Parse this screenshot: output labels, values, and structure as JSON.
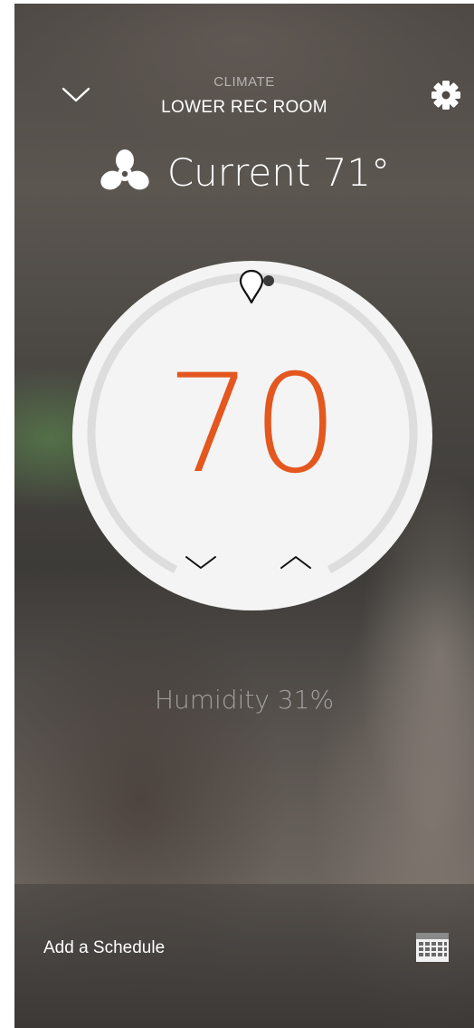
{
  "header": {
    "section_label": "CLIMATE",
    "room_name": "LOWER REC ROOM",
    "back_icon": "chevron-down-icon",
    "settings_icon": "gear-icon"
  },
  "status": {
    "fan_icon": "fan-icon",
    "current_text": "Current 71°"
  },
  "thermostat": {
    "setpoint": "70",
    "decrease_icon": "chevron-down-icon",
    "increase_icon": "chevron-up-icon",
    "setpoint_marker_icon": "map-pin-icon",
    "accent_color": "#e4571f"
  },
  "humidity": {
    "text": "Humidity 31%"
  },
  "footer": {
    "schedule_label": "Add a Schedule",
    "calendar_icon": "calendar-icon"
  }
}
